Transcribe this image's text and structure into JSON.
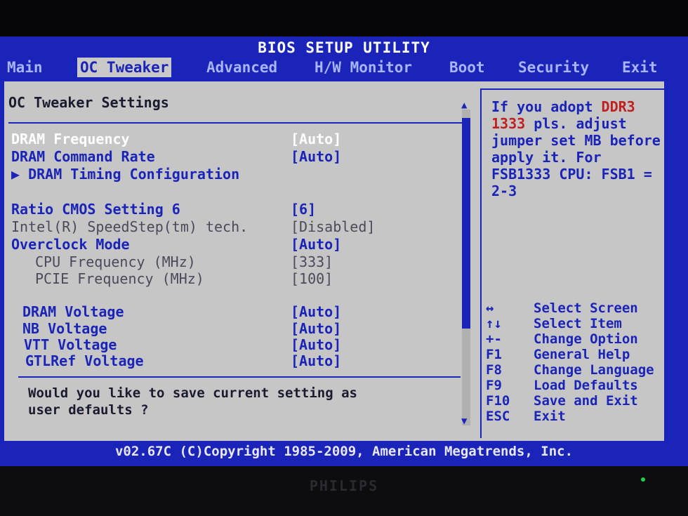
{
  "window": {
    "title": "BIOS SETUP UTILITY"
  },
  "menu": {
    "items": [
      "Main",
      "OC Tweaker",
      "Advanced",
      "H/W Monitor",
      "Boot",
      "Security",
      "Exit"
    ],
    "active_index": 1
  },
  "left_pane": {
    "title": "OC Tweaker Settings",
    "settings": [
      {
        "label": "DRAM Frequency",
        "value": "[Auto]",
        "state": "selected"
      },
      {
        "label": "DRAM Command Rate",
        "value": "[Auto]",
        "state": "active"
      },
      {
        "label": "▶ DRAM Timing Configuration",
        "value": "",
        "state": "active"
      },
      {
        "label": "Ratio CMOS Setting  6",
        "value": "[6]",
        "state": "active"
      },
      {
        "label": "Intel(R) SpeedStep(tm) tech.",
        "value": "[Disabled]",
        "state": "dim"
      },
      {
        "label": "Overclock Mode",
        "value": "[Auto]",
        "state": "active"
      },
      {
        "label": "CPU Frequency (MHz)",
        "value": "[333]",
        "state": "dim"
      },
      {
        "label": "PCIE Frequency (MHz)",
        "value": "[100]",
        "state": "dim"
      },
      {
        "label": "DRAM Voltage",
        "value": "[Auto]",
        "state": "active"
      },
      {
        "label": "NB Voltage",
        "value": "[Auto]",
        "state": "active"
      },
      {
        "label": "VTT Voltage",
        "value": "[Auto]",
        "state": "active"
      },
      {
        "label": "GTLRef Voltage",
        "value": "[Auto]",
        "state": "active"
      }
    ],
    "message": "Would you like to save current setting as\nuser defaults ?"
  },
  "help": {
    "text_before": "If you adopt ",
    "highlight": "DDR3 1333",
    "text_after": " pls. adjust jumper set MB before apply it. For FSB1333 CPU: FSB1 = 2-3"
  },
  "keys": [
    {
      "key": "↔",
      "desc": "Select Screen"
    },
    {
      "key": "↑↓",
      "desc": "Select Item"
    },
    {
      "key": "+-",
      "desc": "Change Option"
    },
    {
      "key": "F1",
      "desc": "General Help"
    },
    {
      "key": "F8",
      "desc": "Change Language"
    },
    {
      "key": "F9",
      "desc": "Load Defaults"
    },
    {
      "key": "F10",
      "desc": "Save and Exit"
    },
    {
      "key": "ESC",
      "desc": "Exit"
    }
  ],
  "footer": "v02.67C (C)Copyright 1985-2009, American Megatrends, Inc.",
  "monitor_brand": "PHILIPS",
  "colors": {
    "screen_bg": "#1b24b8",
    "panel_bg": "#c6c6c6",
    "accent": "#1b24b8",
    "highlight": "#c02020"
  }
}
